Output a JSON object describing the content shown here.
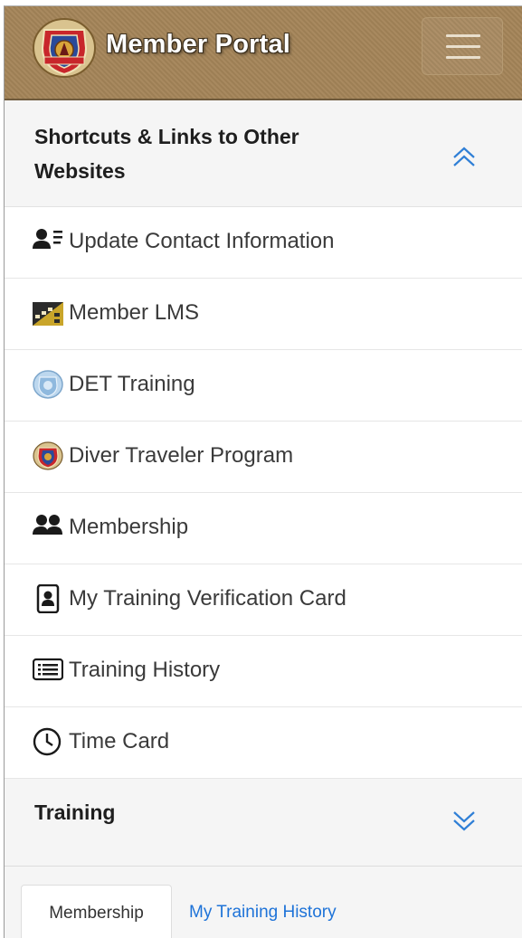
{
  "header": {
    "brand": "Member Portal",
    "logo_icon": "union-seal-icon",
    "menu_icon": "hamburger-menu-icon"
  },
  "shortcuts": {
    "title_line1": "Shortcuts & Links to Other",
    "title_line2": "Websites",
    "state": "expanded",
    "items": [
      {
        "label": "Update Contact Information",
        "icon": "contact-card-icon"
      },
      {
        "label": "Member LMS",
        "icon": "lms-building-icon"
      },
      {
        "label": "DET Training",
        "icon": "det-seal-icon"
      },
      {
        "label": "Diver Traveler Program",
        "icon": "union-seal-icon"
      },
      {
        "label": "Membership",
        "icon": "users-icon"
      },
      {
        "label": "My Training Verification Card",
        "icon": "id-badge-icon"
      },
      {
        "label": "Training History",
        "icon": "list-icon"
      },
      {
        "label": "Time Card",
        "icon": "clock-icon"
      }
    ]
  },
  "training": {
    "title": "Training",
    "state": "collapsed"
  },
  "tabs": [
    {
      "label": "Membership",
      "active": true
    },
    {
      "label": "My Training History",
      "active": false
    }
  ],
  "colors": {
    "header_bg": "#a8895f",
    "accent_link": "#1e73d8",
    "panel_bg": "#f5f5f5"
  }
}
